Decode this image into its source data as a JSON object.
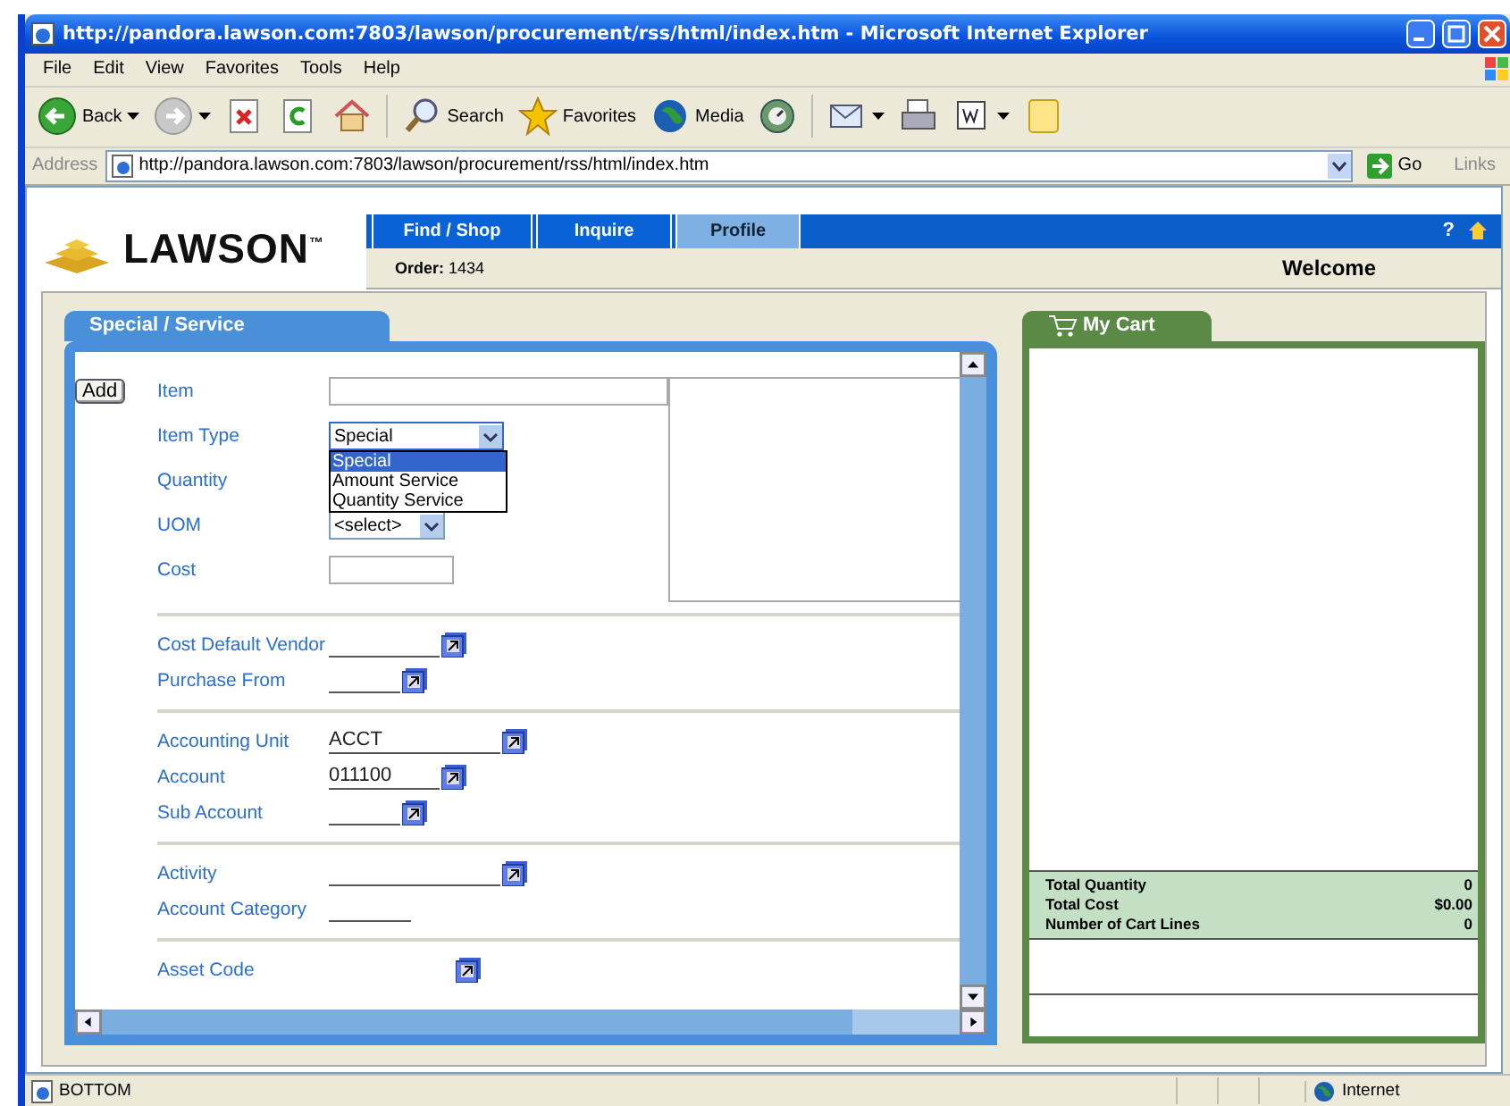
{
  "window": {
    "title": "http://pandora.lawson.com:7803/lawson/procurement/rss/html/index.htm - Microsoft Internet Explorer"
  },
  "menu": [
    "File",
    "Edit",
    "View",
    "Favorites",
    "Tools",
    "Help"
  ],
  "toolbar": [
    {
      "kind": "back",
      "label": "Back",
      "menu": true
    },
    {
      "kind": "forward",
      "menu": true
    },
    {
      "kind": "stop",
      "menu": false
    },
    {
      "kind": "refresh",
      "menu": false
    },
    {
      "kind": "home",
      "menu": false
    },
    {
      "kind": "search",
      "label": "Search",
      "menu": false
    },
    {
      "kind": "favorites",
      "label": "Favorites",
      "menu": false
    },
    {
      "kind": "media",
      "label": "Media",
      "menu": false
    },
    {
      "kind": "history",
      "menu": false
    },
    {
      "kind": "mail",
      "menu": true
    },
    {
      "kind": "print",
      "menu": false
    },
    {
      "kind": "edit",
      "menu": true
    },
    {
      "kind": "note",
      "menu": false
    }
  ],
  "address": {
    "label": "Address",
    "url": "http://pandora.lawson.com:7803/lawson/procurement/rss/html/index.htm",
    "go": "Go",
    "links": "Links"
  },
  "app": {
    "logo": "LAWSON$^{™}$",
    "nav": [
      {
        "label": "Find / Shop",
        "selected": false
      },
      {
        "label": "Inquire",
        "selected": false
      },
      {
        "label": "Profile",
        "selected": true
      }
    ],
    "help": "?",
    "order": {
      "label": "Order:",
      "value": "1434"
    },
    "welcome": "Welcome"
  },
  "form": {
    "tab": "Special / Service",
    "add_button": "Add",
    "top_fields": [
      {
        "label": "Item",
        "kind": "input"
      },
      {
        "label": "Item Type",
        "kind": "select",
        "value": "Special",
        "open": true,
        "options": [
          {
            "label": "Special",
            "selected": true
          },
          {
            "label": "Amount Service",
            "selected": false
          },
          {
            "label": "Quantity Service",
            "selected": false
          }
        ]
      },
      {
        "label": "Quantity",
        "kind": "covered"
      },
      {
        "label": "UOM",
        "kind": "select",
        "value": "<select>",
        "open": false
      },
      {
        "label": "Cost",
        "kind": "input"
      }
    ],
    "sections": [
      [
        {
          "label": "Cost Default Vendor",
          "kind": "lookup"
        },
        {
          "label": "Purchase From",
          "kind": "lookup"
        }
      ],
      [
        {
          "label": "Accounting Unit",
          "kind": "lookup",
          "value": "ACCT"
        },
        {
          "label": "Account",
          "kind": "lookup",
          "value": "011100"
        },
        {
          "label": "Sub Account",
          "kind": "lookup"
        }
      ],
      [
        {
          "label": "Activity",
          "kind": "lookup"
        },
        {
          "label": "Account Category",
          "kind": "line"
        }
      ],
      [
        {
          "label": "Asset Code",
          "kind": "lookup_only"
        }
      ]
    ]
  },
  "cart": {
    "title": "My Cart",
    "totals": [
      {
        "label": "Total Quantity",
        "value": "0"
      },
      {
        "label": "Total Cost",
        "value": "$0.00"
      },
      {
        "label": "Number of Cart Lines",
        "value": "0"
      }
    ]
  },
  "status_bar": {
    "text": "BOTTOM",
    "zone": "Internet"
  }
}
